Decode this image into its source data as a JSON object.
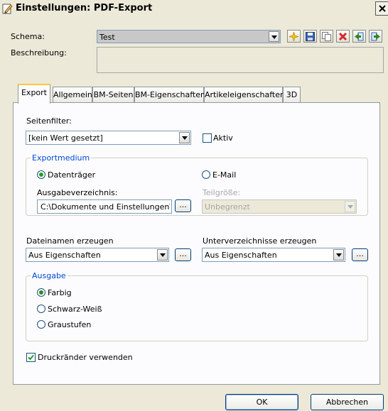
{
  "window": {
    "title": "Einstellungen: PDF-Export"
  },
  "schema": {
    "label": "Schema:",
    "value": "Test",
    "description_label": "Beschreibung:",
    "toolbar_icons": [
      "new-icon",
      "save-icon",
      "copy-icon",
      "delete-icon",
      "import-icon",
      "export-icon"
    ]
  },
  "tabs": [
    {
      "label": "Export",
      "active": true
    },
    {
      "label": "Allgemein"
    },
    {
      "label": "BM-Seiten"
    },
    {
      "label": "BM-Eigenschaften"
    },
    {
      "label": "Artikeleigenschaften"
    },
    {
      "label": "3D"
    }
  ],
  "export": {
    "page_filter_label": "Seitenfilter:",
    "page_filter_value": "[kein Wert gesetzt]",
    "active_label": "Aktiv",
    "active_checked": false,
    "medium": {
      "title": "Exportmedium",
      "option_disk": "Datenträger",
      "option_email": "E-Mail",
      "selected": "Datenträger",
      "output_dir_label": "Ausgabeverzeichnis:",
      "output_dir_value": "C:\\Dokumente und Einstellungen\\paul",
      "part_size_label": "Teilgröße:",
      "part_size_value": "Unbegrenzt"
    },
    "filenames_label": "Dateinamen erzeugen",
    "filenames_value": "Aus Eigenschaften",
    "subdirs_label": "Unterverzeichnisse erzeugen",
    "subdirs_value": "Aus Eigenschaften",
    "output": {
      "title": "Ausgabe",
      "option_color": "Farbig",
      "option_bw": "Schwarz-Weiß",
      "option_gray": "Graustufen",
      "selected": "Farbig"
    },
    "print_margins_label": "Druckränder verwenden",
    "print_margins_checked": true
  },
  "buttons": {
    "ok": "OK",
    "cancel": "Abbrechen",
    "ellipsis": "..."
  }
}
